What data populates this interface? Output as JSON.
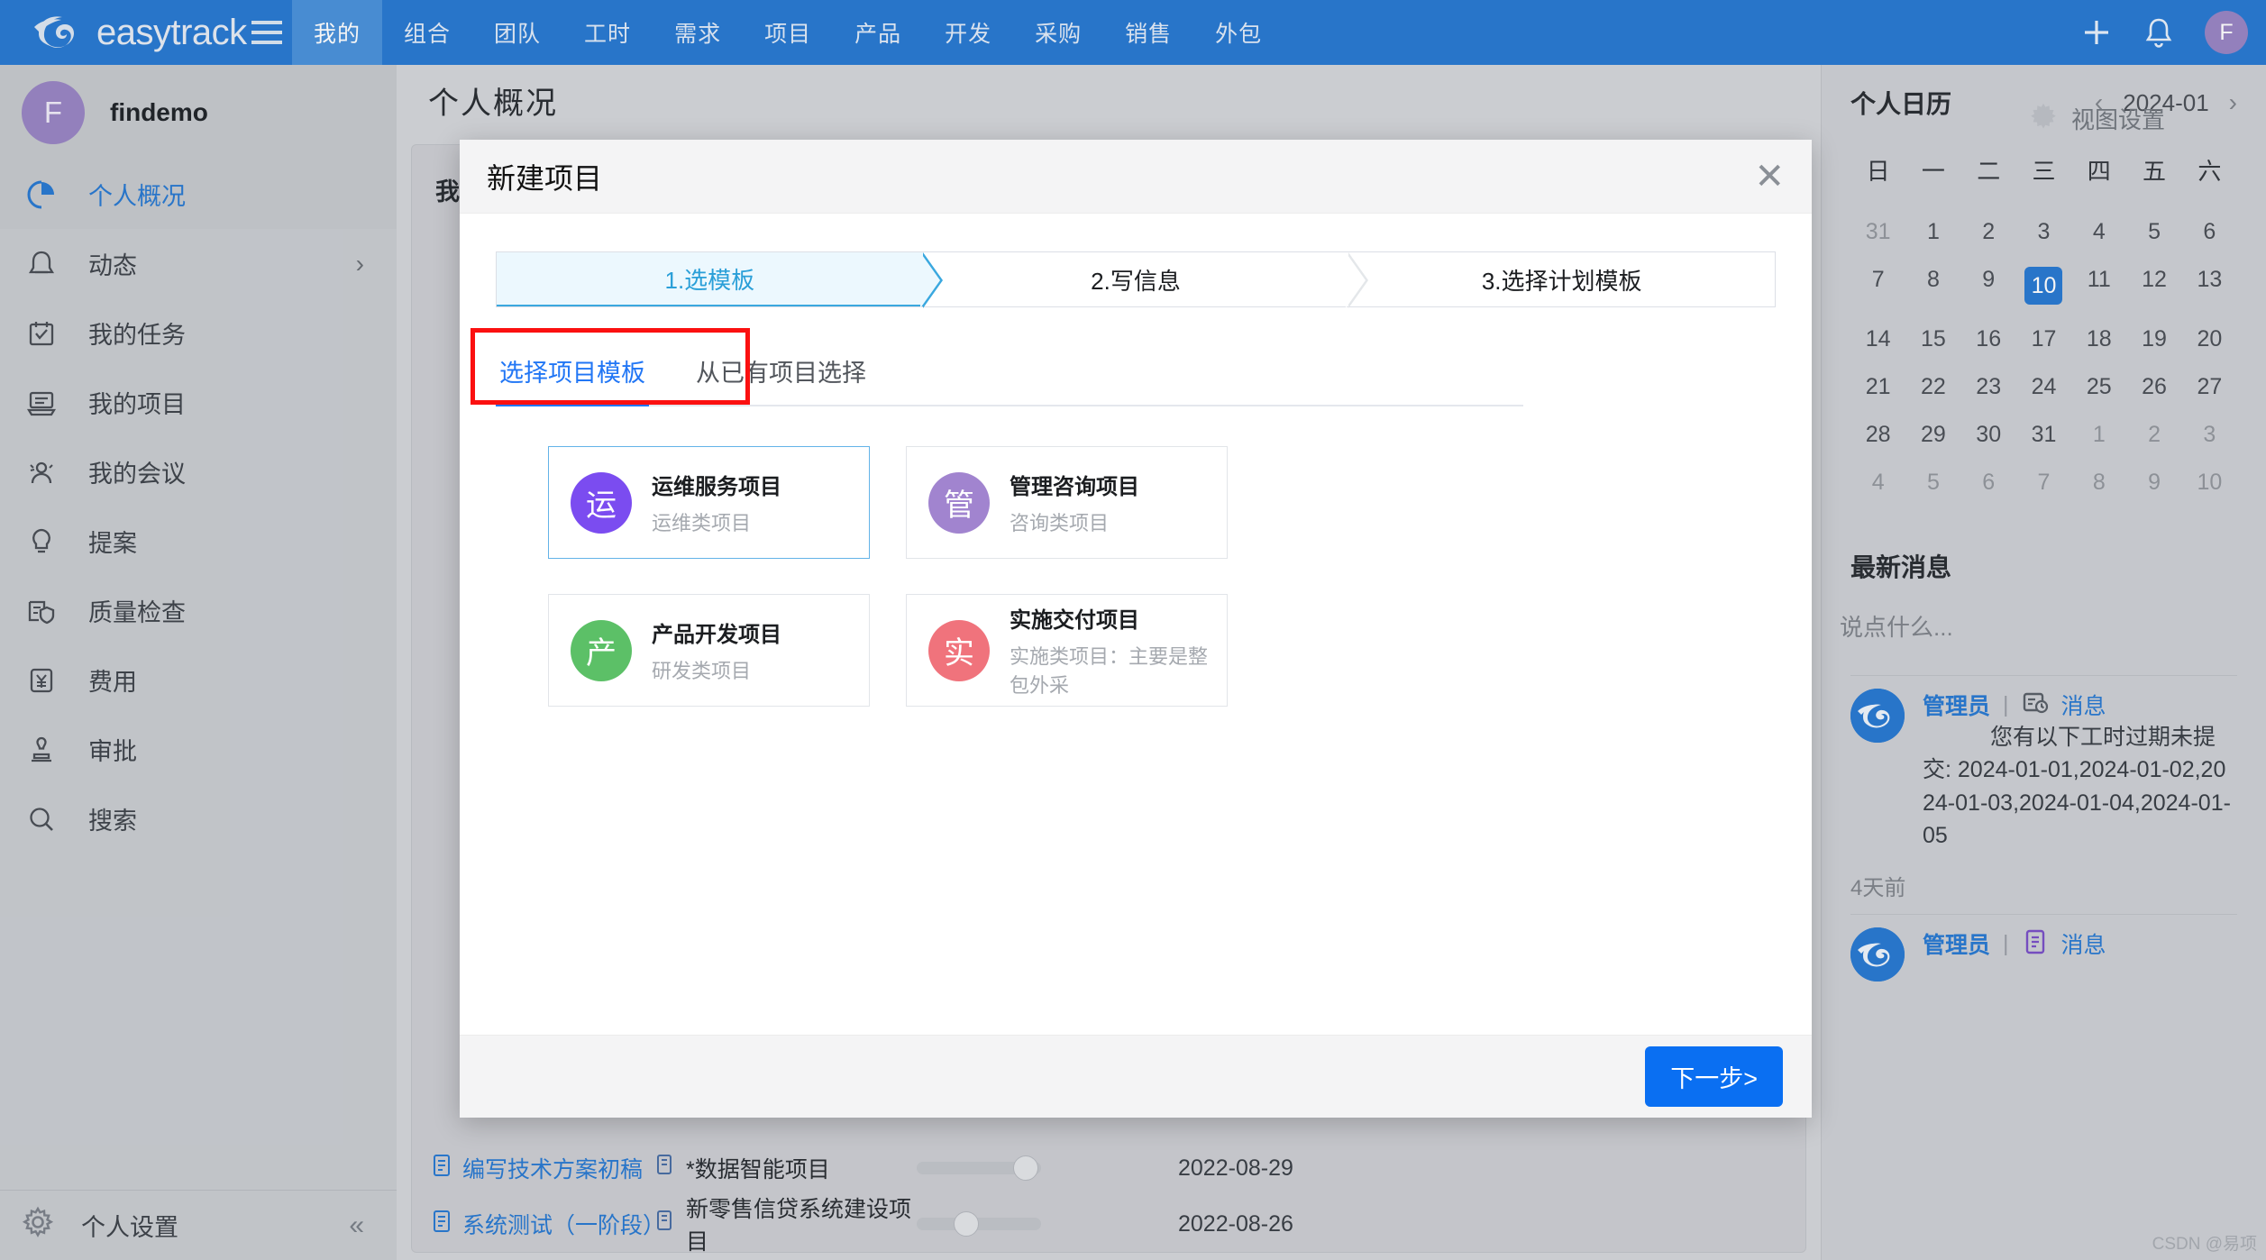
{
  "topnav": {
    "brand": "easytrack",
    "menu_icon": "hamburger-icon",
    "items": [
      {
        "label": "我的",
        "active": true
      },
      {
        "label": "组合",
        "active": false
      },
      {
        "label": "团队",
        "active": false
      },
      {
        "label": "工时",
        "active": false
      },
      {
        "label": "需求",
        "active": false
      },
      {
        "label": "项目",
        "active": false
      },
      {
        "label": "产品",
        "active": false
      },
      {
        "label": "开发",
        "active": false
      },
      {
        "label": "采购",
        "active": false
      },
      {
        "label": "销售",
        "active": false
      },
      {
        "label": "外包",
        "active": false
      }
    ],
    "add_icon": "plus-icon",
    "bell_icon": "bell-icon",
    "avatar_initial": "F"
  },
  "sidebar": {
    "user": {
      "initial": "F",
      "name": "findemo"
    },
    "items": [
      {
        "label": "个人概况",
        "icon": "pie-chart-icon",
        "active": true,
        "chevron": ""
      },
      {
        "label": "动态",
        "icon": "bell-icon",
        "active": false,
        "chevron": "›"
      },
      {
        "label": "我的任务",
        "icon": "task-check-icon",
        "active": false,
        "chevron": ""
      },
      {
        "label": "我的项目",
        "icon": "project-box-icon",
        "active": false,
        "chevron": ""
      },
      {
        "label": "我的会议",
        "icon": "people-meeting-icon",
        "active": false,
        "chevron": ""
      },
      {
        "label": "提案",
        "icon": "lightbulb-icon",
        "active": false,
        "chevron": ""
      },
      {
        "label": "质量检查",
        "icon": "quality-shield-icon",
        "active": false,
        "chevron": ""
      },
      {
        "label": "费用",
        "icon": "yen-expense-icon",
        "active": false,
        "chevron": ""
      },
      {
        "label": "审批",
        "icon": "stamp-approve-icon",
        "active": false,
        "chevron": ""
      },
      {
        "label": "搜索",
        "icon": "magnifier-icon",
        "active": false,
        "chevron": ""
      }
    ],
    "bottom": {
      "label": "个人设置",
      "icon": "gear-icon",
      "collapse": "«"
    }
  },
  "main": {
    "page_title": "个人概况",
    "view_settings": {
      "label": "视图设置",
      "icon": "gear-icon"
    },
    "card_title": "我",
    "rows": [
      {
        "task": "编写技术方案初稿",
        "project": "*数据智能项目",
        "progress": 88,
        "color": "#dda13f",
        "date": "2022-08-29"
      },
      {
        "task": "系统测试（一阶段）",
        "project": "新零售信贷系统建设项目",
        "progress": 40,
        "color": "#d9455f",
        "date": "2022-08-26"
      }
    ]
  },
  "right_panel": {
    "calendar": {
      "title": "个人日历",
      "month": "2024-01",
      "prev_icon": "chevron-left-icon",
      "next_icon": "chevron-right-icon",
      "dow": [
        "日",
        "一",
        "二",
        "三",
        "四",
        "五",
        "六"
      ],
      "weeks": [
        [
          {
            "d": "31",
            "muted": true
          },
          {
            "d": "1"
          },
          {
            "d": "2"
          },
          {
            "d": "3"
          },
          {
            "d": "4"
          },
          {
            "d": "5"
          },
          {
            "d": "6"
          }
        ],
        [
          {
            "d": "7"
          },
          {
            "d": "8"
          },
          {
            "d": "9"
          },
          {
            "d": "10",
            "selected": true
          },
          {
            "d": "11"
          },
          {
            "d": "12"
          },
          {
            "d": "13"
          }
        ],
        [
          {
            "d": "14"
          },
          {
            "d": "15"
          },
          {
            "d": "16"
          },
          {
            "d": "17"
          },
          {
            "d": "18"
          },
          {
            "d": "19"
          },
          {
            "d": "20"
          }
        ],
        [
          {
            "d": "21"
          },
          {
            "d": "22"
          },
          {
            "d": "23"
          },
          {
            "d": "24"
          },
          {
            "d": "25"
          },
          {
            "d": "26"
          },
          {
            "d": "27"
          }
        ],
        [
          {
            "d": "28"
          },
          {
            "d": "29"
          },
          {
            "d": "30"
          },
          {
            "d": "31"
          },
          {
            "d": "1",
            "muted": true
          },
          {
            "d": "2",
            "muted": true
          },
          {
            "d": "3",
            "muted": true
          }
        ],
        [
          {
            "d": "4",
            "muted": true
          },
          {
            "d": "5",
            "muted": true
          },
          {
            "d": "6",
            "muted": true
          },
          {
            "d": "7",
            "muted": true
          },
          {
            "d": "8",
            "muted": true
          },
          {
            "d": "9",
            "muted": true
          },
          {
            "d": "10",
            "muted": true
          }
        ]
      ]
    },
    "messages": {
      "title": "最新消息",
      "input_placeholder": "说点什么...",
      "items": [
        {
          "user": "管理员",
          "separator": "|",
          "type_icon": "message-clock-icon",
          "type": "消息",
          "text": "您有以下工时过期未提交: 2024-01-01,2024-01-02,2024-01-03,2024-01-04,2024-01-05",
          "time": "4天前"
        },
        {
          "user": "管理员",
          "separator": "|",
          "type_icon": "message-doc-icon",
          "type": "消息",
          "text": "",
          "time": ""
        }
      ]
    },
    "watermark": "CSDN @易项"
  },
  "modal": {
    "title": "新建项目",
    "close_icon": "close-icon",
    "steps": [
      {
        "label": "1.选模板",
        "active": true
      },
      {
        "label": "2.写信息",
        "active": false
      },
      {
        "label": "3.选择计划模板",
        "active": false
      }
    ],
    "tabs": [
      {
        "label": "选择项目模板",
        "active": true
      },
      {
        "label": "从已有项目选择",
        "active": false
      }
    ],
    "templates": [
      {
        "badge": "运",
        "color": "#7b4cf0",
        "name": "运维服务项目",
        "desc": "运维类项目",
        "selected": true
      },
      {
        "badge": "管",
        "color": "#a184cf",
        "name": "管理咨询项目",
        "desc": "咨询类项目",
        "selected": false
      },
      {
        "badge": "产",
        "color": "#5cc067",
        "name": "产品开发项目",
        "desc": "研发类项目",
        "selected": false
      },
      {
        "badge": "实",
        "color": "#f0737c",
        "name": "实施交付项目",
        "desc": "实施类项目：主要是整包外采",
        "selected": false
      }
    ],
    "next_label": "下一步>"
  }
}
